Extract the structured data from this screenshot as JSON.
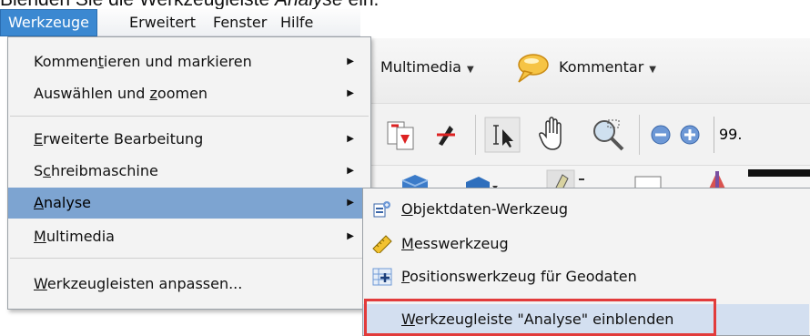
{
  "caption": {
    "prefix": "Blenden Sie die Werkzeugleiste ",
    "italic": "Analyse",
    "suffix": " ein."
  },
  "menubar": {
    "items": [
      "Werkzeuge",
      "Erweitert",
      "Fenster",
      "Hilfe"
    ]
  },
  "background_toolbar": {
    "multimedia_label": "Multimedia",
    "kommentar_label": "Kommentar",
    "zoom_value": "99."
  },
  "menu": {
    "items": [
      {
        "pre": "Kommen",
        "ul": "t",
        "post": "ieren und markieren"
      },
      {
        "pre": "Auswählen und ",
        "ul": "z",
        "post": "oomen"
      },
      {
        "pre": "",
        "ul": "E",
        "post": "rweiterte Bearbeitung"
      },
      {
        "pre": "S",
        "ul": "c",
        "post": "hreibmaschine"
      },
      {
        "pre": "",
        "ul": "A",
        "post": "nalyse"
      },
      {
        "pre": "",
        "ul": "M",
        "post": "ultimedia"
      },
      {
        "pre": "",
        "ul": "W",
        "post": "erkzeugleisten anpassen..."
      }
    ]
  },
  "submenu": {
    "items": [
      {
        "pre": "",
        "ul": "O",
        "post": "bjektdaten-Werkzeug",
        "icon": "object-data-icon"
      },
      {
        "pre": "",
        "ul": "M",
        "post": "esswerkzeug",
        "icon": "ruler-icon"
      },
      {
        "pre": "",
        "ul": "P",
        "post": "ositionswerkzeug für Geodaten",
        "icon": "geo-position-icon"
      },
      {
        "pre": "",
        "ul": "W",
        "post": "erkzeugleiste \"Analyse\" einblenden",
        "icon": ""
      }
    ]
  },
  "colors": {
    "menubar_active": "#3b88d1",
    "menu_highlight": "#7da4d1",
    "callout_border": "#e23b3b"
  }
}
